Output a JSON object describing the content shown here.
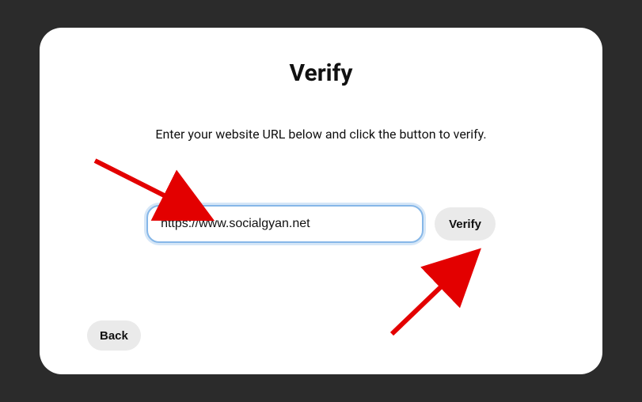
{
  "modal": {
    "title": "Verify",
    "instruction": "Enter your website URL below and click the button to verify.",
    "url_input_value": "https://www.socialgyan.net",
    "verify_button_label": "Verify",
    "back_button_label": "Back"
  },
  "annotations": {
    "arrow1_color": "#e30000",
    "arrow2_color": "#e30000"
  }
}
